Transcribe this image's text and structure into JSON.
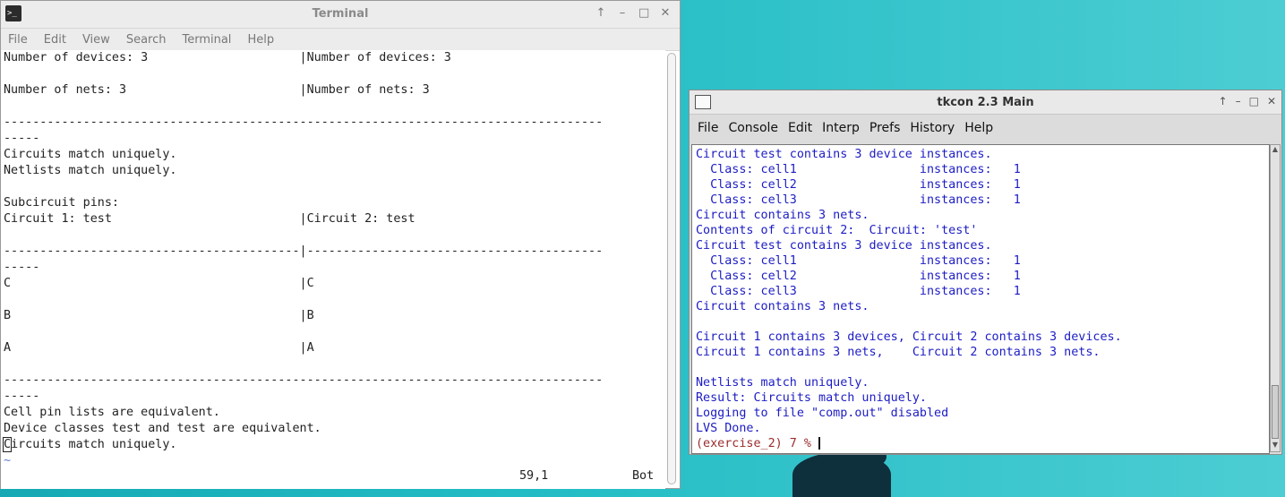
{
  "terminal": {
    "title": "Terminal",
    "controls": [
      "↑",
      "–",
      "□",
      "✕"
    ],
    "menu": [
      "File",
      "Edit",
      "View",
      "Search",
      "Terminal",
      "Help"
    ],
    "lines": [
      "Number of devices: 3                     |Number of devices: 3",
      "",
      "Number of nets: 3                        |Number of nets: 3",
      "",
      "-----------------------------------------------------------------------------------",
      "-----",
      "Circuits match uniquely.",
      "Netlists match uniquely.",
      "",
      "Subcircuit pins:",
      "Circuit 1: test                          |Circuit 2: test",
      "",
      "-----------------------------------------|-----------------------------------------",
      "-----",
      "C                                        |C",
      "",
      "B                                        |B",
      "",
      "A                                        |A",
      "",
      "-----------------------------------------------------------------------------------",
      "-----",
      "Cell pin lists are equivalent.",
      "Device classes test and test are equivalent.",
      "Circuits match uniquely.",
      "~"
    ],
    "status_position": "59,1",
    "status_scroll": "Bot"
  },
  "tkcon": {
    "title": "tkcon 2.3 Main",
    "controls": [
      "↑",
      "–",
      "□",
      "✕"
    ],
    "menu": [
      "File",
      "Console",
      "Edit",
      "Interp",
      "Prefs",
      "History",
      "Help"
    ],
    "lines": [
      "Circuit test contains 3 device instances.",
      "  Class: cell1                 instances:   1",
      "  Class: cell2                 instances:   1",
      "  Class: cell3                 instances:   1",
      "Circuit contains 3 nets.",
      "Contents of circuit 2:  Circuit: 'test'",
      "Circuit test contains 3 device instances.",
      "  Class: cell1                 instances:   1",
      "  Class: cell2                 instances:   1",
      "  Class: cell3                 instances:   1",
      "Circuit contains 3 nets.",
      "",
      "Circuit 1 contains 3 devices, Circuit 2 contains 3 devices.",
      "Circuit 1 contains 3 nets,    Circuit 2 contains 3 nets.",
      "",
      "Netlists match uniquely.",
      "Result: Circuits match uniquely.",
      "Logging to file \"comp.out\" disabled",
      "LVS Done."
    ],
    "prompt": "(exercise_2) 7 % "
  }
}
